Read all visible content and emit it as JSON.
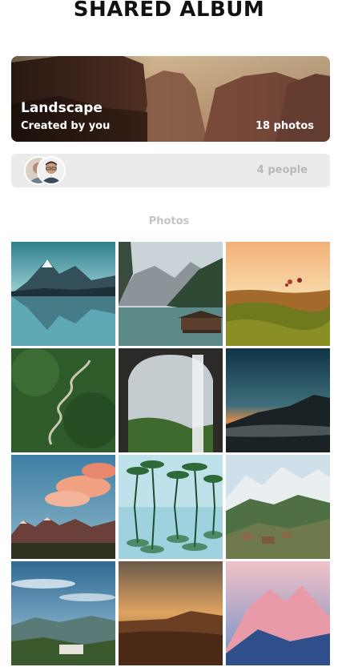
{
  "header": {
    "title": "SHARED ALBUM"
  },
  "album": {
    "name": "Landscape",
    "created_by": "Created by you",
    "photo_count": "18 photos"
  },
  "members": {
    "count_label": "4 people",
    "avatars": [
      "avatar-1",
      "avatar-2"
    ]
  },
  "photos_section": {
    "label": "Photos"
  },
  "photos": [
    {
      "name": "mountain-lake-reflection"
    },
    {
      "name": "dolomites-boathouse"
    },
    {
      "name": "balloons-over-valley"
    },
    {
      "name": "winding-mountain-road"
    },
    {
      "name": "waterfall-from-cave"
    },
    {
      "name": "dusk-mountain-fog"
    },
    {
      "name": "pink-clouds-over-peaks"
    },
    {
      "name": "palm-trees-reflection"
    },
    {
      "name": "snowy-peaks-village"
    },
    {
      "name": "blue-sky-hill-town"
    },
    {
      "name": "desert-sunset-dunes"
    },
    {
      "name": "pink-snowy-mountain"
    }
  ],
  "colors": {
    "title": "#111111",
    "muted": "#c4c4c4",
    "panel": "#ebebeb"
  }
}
